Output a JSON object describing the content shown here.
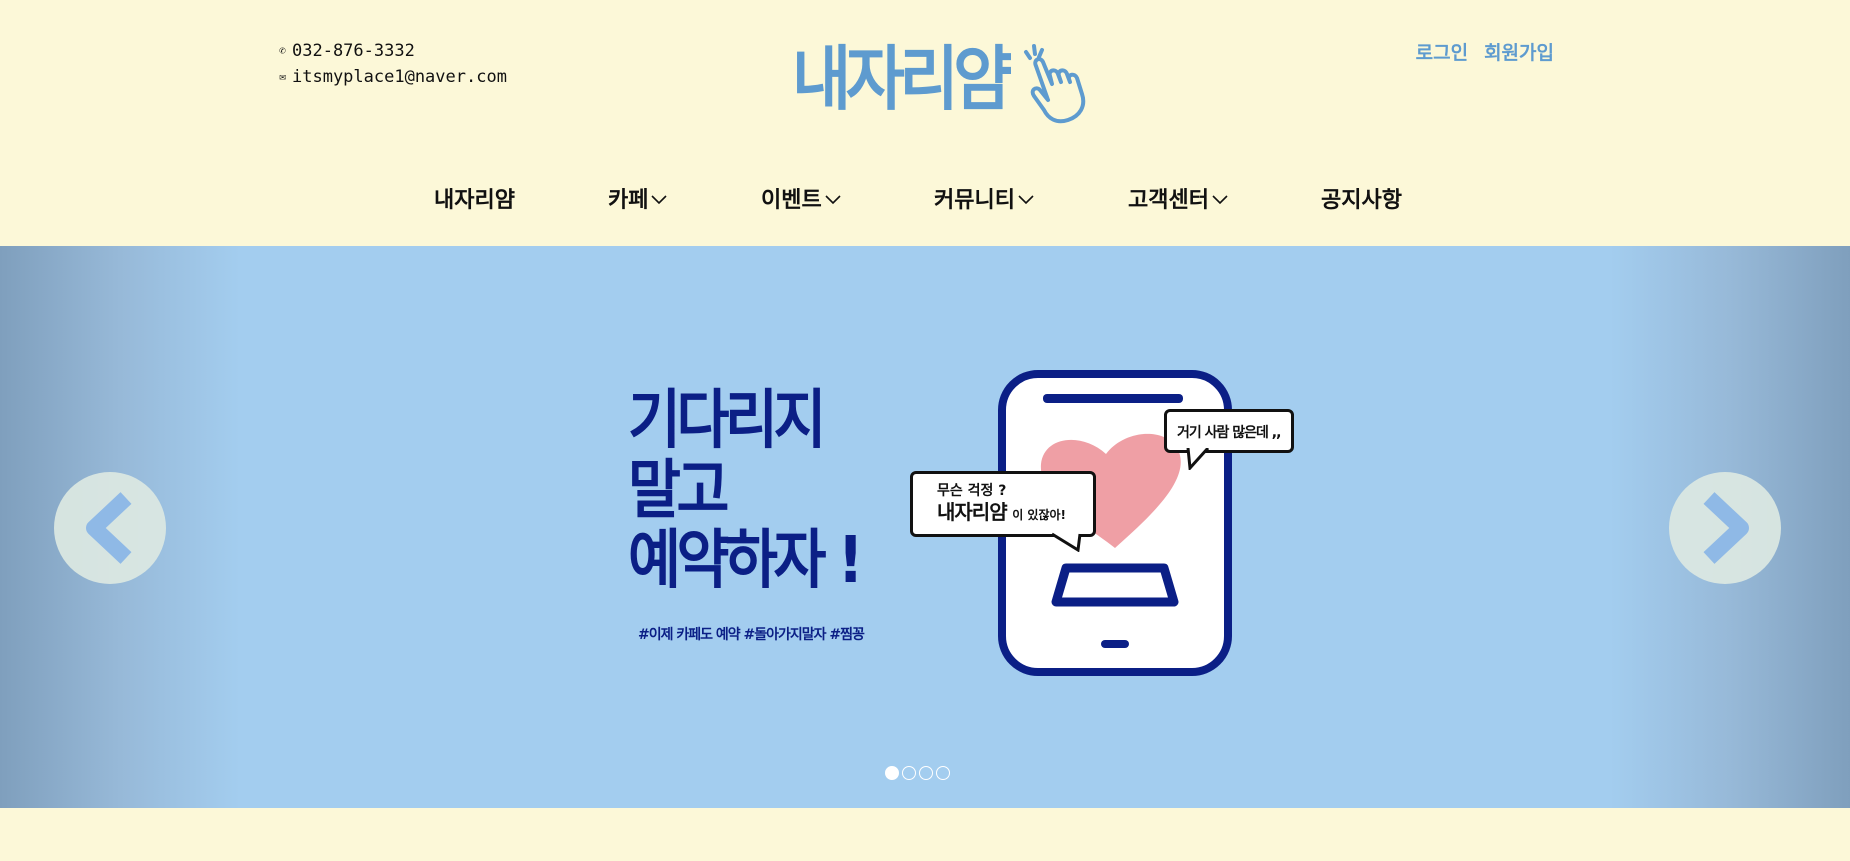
{
  "header": {
    "phone": "032-876-3332",
    "email": "itsmyplace1@naver.com",
    "logo_text": "내자리얌",
    "auth": {
      "login": "로그인",
      "signup": "회원가입"
    }
  },
  "nav": {
    "items": [
      {
        "label": "내자리얌",
        "dropdown": false
      },
      {
        "label": "카페",
        "dropdown": true
      },
      {
        "label": "이벤트",
        "dropdown": true
      },
      {
        "label": "커뮤니티",
        "dropdown": true
      },
      {
        "label": "고객센터",
        "dropdown": true
      },
      {
        "label": "공지사항",
        "dropdown": false
      }
    ]
  },
  "hero": {
    "headline": [
      "기다리지",
      "말고",
      "예약하자 !"
    ],
    "hashtags": "#이제 카페도 예약 #돌아가지말자 #찜꽁",
    "bubble_left": {
      "question": "무슨 걱정 ?",
      "brand": "내자리얌",
      "suffix": "이 있잖아!"
    },
    "bubble_right": "거기 사람 많은데 ,,",
    "slides_total": 4,
    "active_slide": 1
  },
  "colors": {
    "background": "#fcf8d8",
    "brand_blue": "#5e9bcf",
    "hero_bg": "#a3cdef",
    "navy": "#0b1f86",
    "heart": "#ef9fa5"
  },
  "icons": {
    "phone": "phone-icon",
    "email": "envelope-icon",
    "chevron": "chevron-down-icon",
    "prev": "chevron-left-icon",
    "next": "chevron-right-icon",
    "hand": "pointing-hand-icon",
    "phone_illustration": "smartphone-heart-illustration"
  }
}
